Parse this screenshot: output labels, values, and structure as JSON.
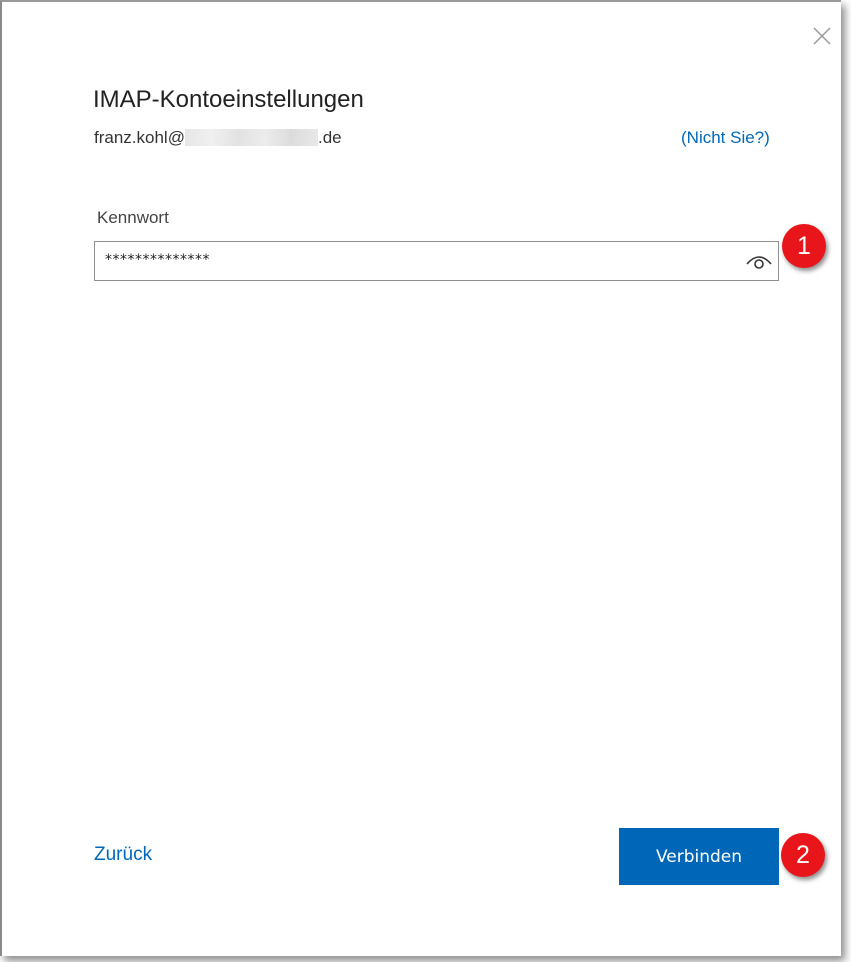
{
  "dialog": {
    "title": "IMAP-Kontoeinstellungen",
    "email_prefix": "franz.kohl@",
    "email_suffix": ".de",
    "not_you_link": "(Nicht Sie?)"
  },
  "password": {
    "label": "Kennwort",
    "value": "**************",
    "reveal_icon": "eye-icon",
    "close_icon": "close-icon"
  },
  "footer": {
    "back_label": "Zurück",
    "connect_label": "Verbinden"
  },
  "annotations": {
    "marker_1": "1",
    "marker_2": "2"
  },
  "colors": {
    "accent": "#0067b8",
    "marker": "#e8161b"
  }
}
